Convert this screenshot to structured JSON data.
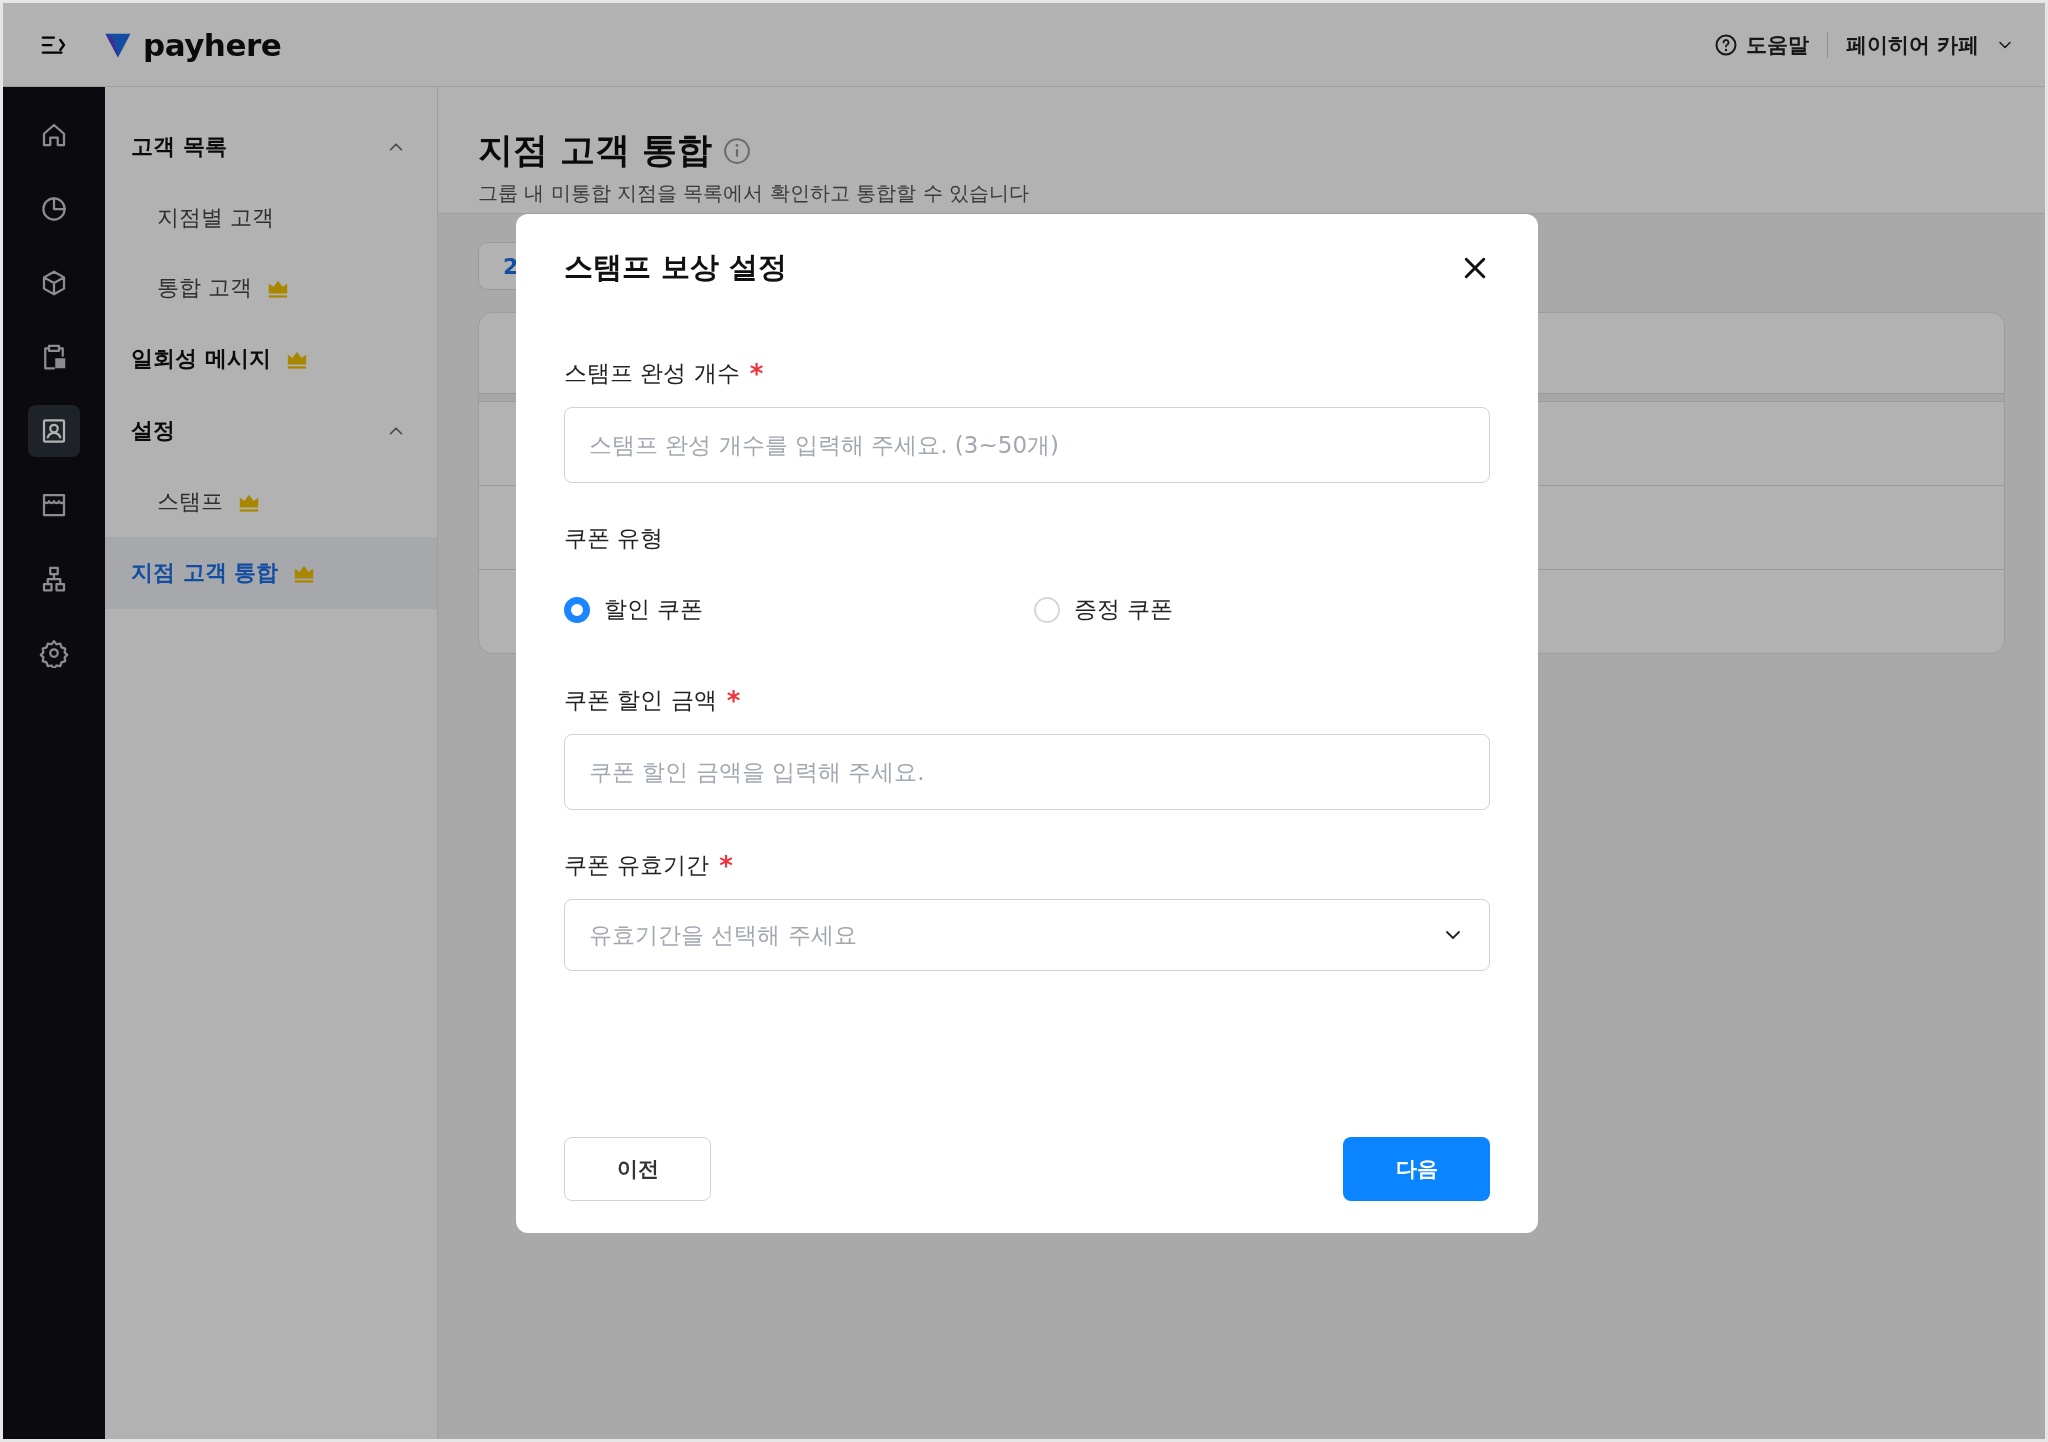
{
  "topbar": {
    "brand": "payhere",
    "help": "도움말",
    "store": "페이히어 카페"
  },
  "rail_items": [
    {
      "selected": false
    },
    {
      "selected": false
    },
    {
      "selected": false
    },
    {
      "selected": false
    },
    {
      "selected": true
    },
    {
      "selected": false
    },
    {
      "selected": false
    },
    {
      "selected": false
    }
  ],
  "sidebar": {
    "items": [
      {
        "label": "고객 목록",
        "premium": false,
        "selected": false,
        "expanded": true,
        "children": [
          {
            "label": "지점별 고객",
            "premium": false,
            "selected": false
          },
          {
            "label": "통합 고객",
            "premium": true,
            "selected": false
          }
        ]
      },
      {
        "label": "일회성 메시지",
        "premium": true,
        "selected": false
      },
      {
        "label": "설정",
        "premium": false,
        "selected": false,
        "expanded": true,
        "children": [
          {
            "label": "스탬프",
            "premium": true,
            "selected": false
          }
        ]
      },
      {
        "label": "지점 고객 통합",
        "premium": true,
        "selected": true
      }
    ]
  },
  "page": {
    "title": "지점 고객 통합",
    "subtitle": "그룹 내 미통합 지점을 목록에서 확인하고 통합할 수 있습니다",
    "chip": "2"
  },
  "modal": {
    "title": "스탬프 보상 설정",
    "fields": [
      {
        "kind": "input",
        "label": "스탬프 완성 개수",
        "required_mark": "*",
        "placeholder": "스탬프 완성 개수를 입력해 주세요. (3~50개)"
      },
      {
        "kind": "radio",
        "label": "쿠폰 유형",
        "options": [
          {
            "label": "할인 쿠폰",
            "selected": true
          },
          {
            "label": "증정 쿠폰",
            "selected": false
          }
        ]
      },
      {
        "kind": "input",
        "label": "쿠폰 할인 금액",
        "required_mark": "*",
        "placeholder": "쿠폰 할인 금액을 입력해 주세요."
      },
      {
        "kind": "select",
        "label": "쿠폰 유효기간",
        "required_mark": "*",
        "placeholder": "유효기간을 선택해 주세요"
      }
    ],
    "buttons": [
      {
        "kind": "secondary",
        "label": "이전"
      },
      {
        "kind": "primary",
        "label": "다음"
      }
    ]
  }
}
